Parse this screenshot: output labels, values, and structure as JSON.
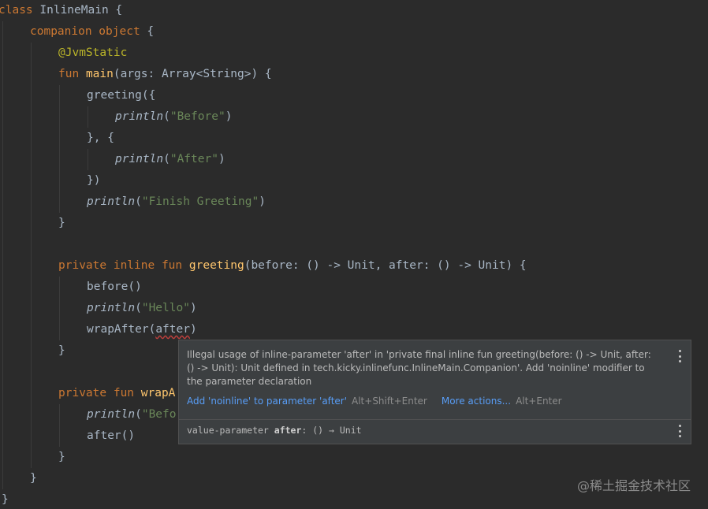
{
  "code": {
    "l1": {
      "kw": "class",
      "name": " InlineMain {"
    },
    "l2": {
      "kw": "companion object",
      "rest": " {"
    },
    "l3": {
      "ann": "@JvmStatic"
    },
    "l4": {
      "kw": "fun",
      "sp": " ",
      "fn": "main",
      "rest": "(args: Array<String>) {"
    },
    "l5": {
      "text": "greeting({"
    },
    "l6": {
      "call": "println",
      "open": "(",
      "str": "\"Before\"",
      "close": ")"
    },
    "l7": {
      "text": "}, {"
    },
    "l8": {
      "call": "println",
      "open": "(",
      "str": "\"After\"",
      "close": ")"
    },
    "l9": {
      "text": "})"
    },
    "l10": {
      "call": "println",
      "open": "(",
      "str": "\"Finish Greeting\"",
      "close": ")"
    },
    "l11": {
      "text": "}"
    },
    "l13": {
      "kw": "private inline fun",
      "sp": " ",
      "fn": "greeting",
      "rest": "(before: () -> Unit, after: () -> Unit) {"
    },
    "l14": {
      "text": "before()"
    },
    "l15": {
      "call": "println",
      "open": "(",
      "str": "\"Hello\"",
      "close": ")"
    },
    "l16": {
      "pre": "wrapAfter(",
      "err": "after",
      "post": ")"
    },
    "l17": {
      "text": "}"
    },
    "l19": {
      "kw": "private fun",
      "sp": " ",
      "fn": "wrapA"
    },
    "l20": {
      "call": "println",
      "open": "(",
      "str": "\"Befo"
    },
    "l21": {
      "text": "after()"
    },
    "l22": {
      "text": "}"
    },
    "l23": {
      "text": "}"
    },
    "l24": {
      "text": "}"
    }
  },
  "popup": {
    "message": "Illegal usage of inline-parameter 'after' in 'private final inline fun greeting(before: () -> Unit, after: () -> Unit): Unit defined in tech.kicky.inlinefunc.InlineMain.Companion'. Add 'noinline' modifier to the parameter declaration",
    "fix_action": "Add 'noinline' to parameter 'after'",
    "fix_shortcut": "Alt+Shift+Enter",
    "more_action": "More actions...",
    "more_shortcut": "Alt+Enter",
    "decl_prefix": "value-parameter ",
    "decl_name": "after",
    "decl_type": ": () → Unit",
    "menu_icon": "kebab-menu-icon"
  },
  "watermark": "@稀土掘金技术社区",
  "colors": {
    "background": "#2b2b2b",
    "keyword": "#cc7832",
    "function": "#ffc66d",
    "annotation": "#bbb529",
    "string": "#6a8759",
    "text": "#a9b7c6",
    "link": "#589df6",
    "error": "#bc3f3c"
  }
}
